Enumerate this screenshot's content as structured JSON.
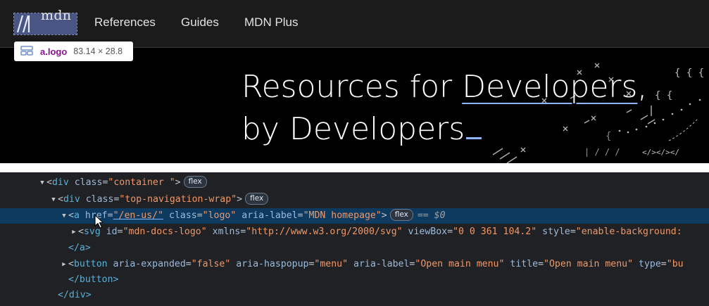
{
  "site": {
    "logo_text": "mdn",
    "nav": [
      "References",
      "Guides",
      "MDN Plus"
    ]
  },
  "tooltip": {
    "selector": "a.logo",
    "dimensions": "83.14 × 28.8"
  },
  "hero": {
    "line1_prefix": "Resources for ",
    "line1_link": "Developers",
    "line1_suffix": ",",
    "line2": "by Developers"
  },
  "devtools": {
    "badge": "flex",
    "selected_marker": "== $0",
    "lines": {
      "l1": {
        "tag": "div",
        "attr1": "class",
        "val1": "\"container \""
      },
      "l2": {
        "tag": "div",
        "attr1": "class",
        "val1": "\"top-navigation-wrap\""
      },
      "l3": {
        "tag": "a",
        "attr1": "href",
        "val1": "\"/en-us/\"",
        "attr2": "class",
        "val2": "\"logo\"",
        "attr3": "aria-label",
        "val3": "\"MDN homepage\""
      },
      "l4": {
        "tag": "svg",
        "attr1": "id",
        "val1": "\"mdn-docs-logo\"",
        "attr2": "xmlns",
        "val2": "\"http://www.w3.org/2000/svg\"",
        "attr3": "viewBox",
        "val3": "\"0 0 361 104.2\"",
        "attr4": "style",
        "val4": "\"enable-background:"
      },
      "l5": {
        "close": "</a>"
      },
      "l6": {
        "tag": "button",
        "attr1": "aria-expanded",
        "val1": "\"false\"",
        "attr2": "aria-haspopup",
        "val2": "\"menu\"",
        "attr3": "aria-label",
        "val3": "\"Open main menu\"",
        "attr4": "title",
        "val4": "\"Open main menu\"",
        "attr5": "type",
        "val5": "\"bu"
      },
      "l7": {
        "close": "</button>"
      },
      "l8": {
        "close": "</div>"
      }
    }
  },
  "colors": {
    "selected_row": "#0f3a5f",
    "tag": "#5db0d7",
    "attribute_name": "#9bbbdc",
    "attribute_value": "#f29766",
    "logo_highlight": "#6f85d7",
    "accent": "#8cb4ff"
  },
  "icons": [
    "mdn-logo-icon",
    "layout-grid-icon",
    "expand-triangle-icon",
    "collapse-triangle-icon",
    "mouse-pointer-icon"
  ]
}
